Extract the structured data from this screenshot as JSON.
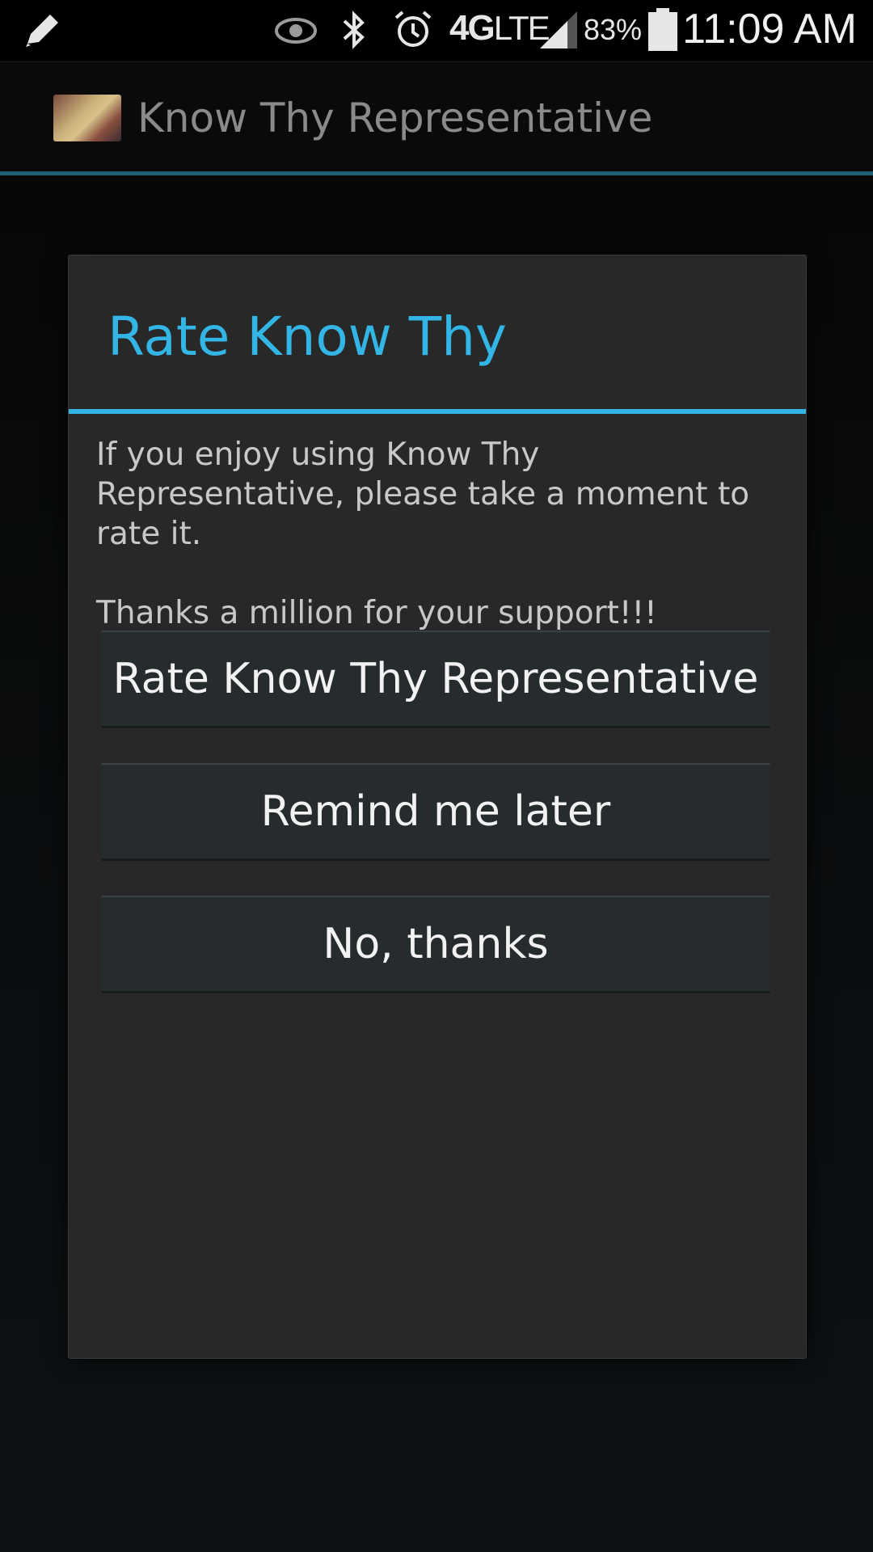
{
  "status_bar": {
    "network": "4G",
    "network_suffix": "LTE",
    "battery": "83%",
    "time": "11:09 AM",
    "icons": [
      "pencil-icon",
      "eye-icon",
      "bluetooth-icon",
      "alarm-icon",
      "signal-icon",
      "battery-icon"
    ]
  },
  "action_bar": {
    "title": "Know Thy Representative",
    "icon": "app-logo-icon"
  },
  "dialog": {
    "title": "Rate Know Thy",
    "message_line1": "If you enjoy using Know Thy Representative, please take a moment to rate it.",
    "message_line2": "Thanks a million for your support!!!",
    "buttons": {
      "rate": "Rate Know Thy Representative",
      "later": "Remind me later",
      "no": "No, thanks"
    }
  },
  "colors": {
    "accent": "#33b5e5",
    "action_bar_divider": "#1f5f73",
    "dialog_background": "#282828"
  }
}
